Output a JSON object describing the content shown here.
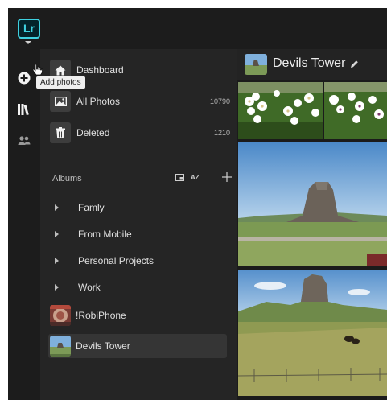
{
  "app": {
    "logo_text": "Lr",
    "accent": "#3fd1e0"
  },
  "rail": {
    "items": [
      {
        "name": "add-photos",
        "icon": "plus-circle-icon"
      },
      {
        "name": "library",
        "icon": "library-icon"
      },
      {
        "name": "people",
        "icon": "people-icon"
      }
    ],
    "tooltip": "Add photos"
  },
  "nav": {
    "items": [
      {
        "label": "Dashboard",
        "icon": "home-icon",
        "count": ""
      },
      {
        "label": "All Photos",
        "icon": "image-icon",
        "count": "10790"
      },
      {
        "label": "Deleted",
        "icon": "trash-icon",
        "count": "1210"
      }
    ]
  },
  "albums": {
    "title": "Albums",
    "sort_label": "AZ",
    "items": [
      {
        "label": "Famly"
      },
      {
        "label": "From Mobile"
      },
      {
        "label": "Personal Projects"
      },
      {
        "label": "Work"
      },
      {
        "label": "!RobiPhone"
      },
      {
        "label": "Devils Tower"
      }
    ]
  },
  "content": {
    "title": "Devils Tower"
  }
}
